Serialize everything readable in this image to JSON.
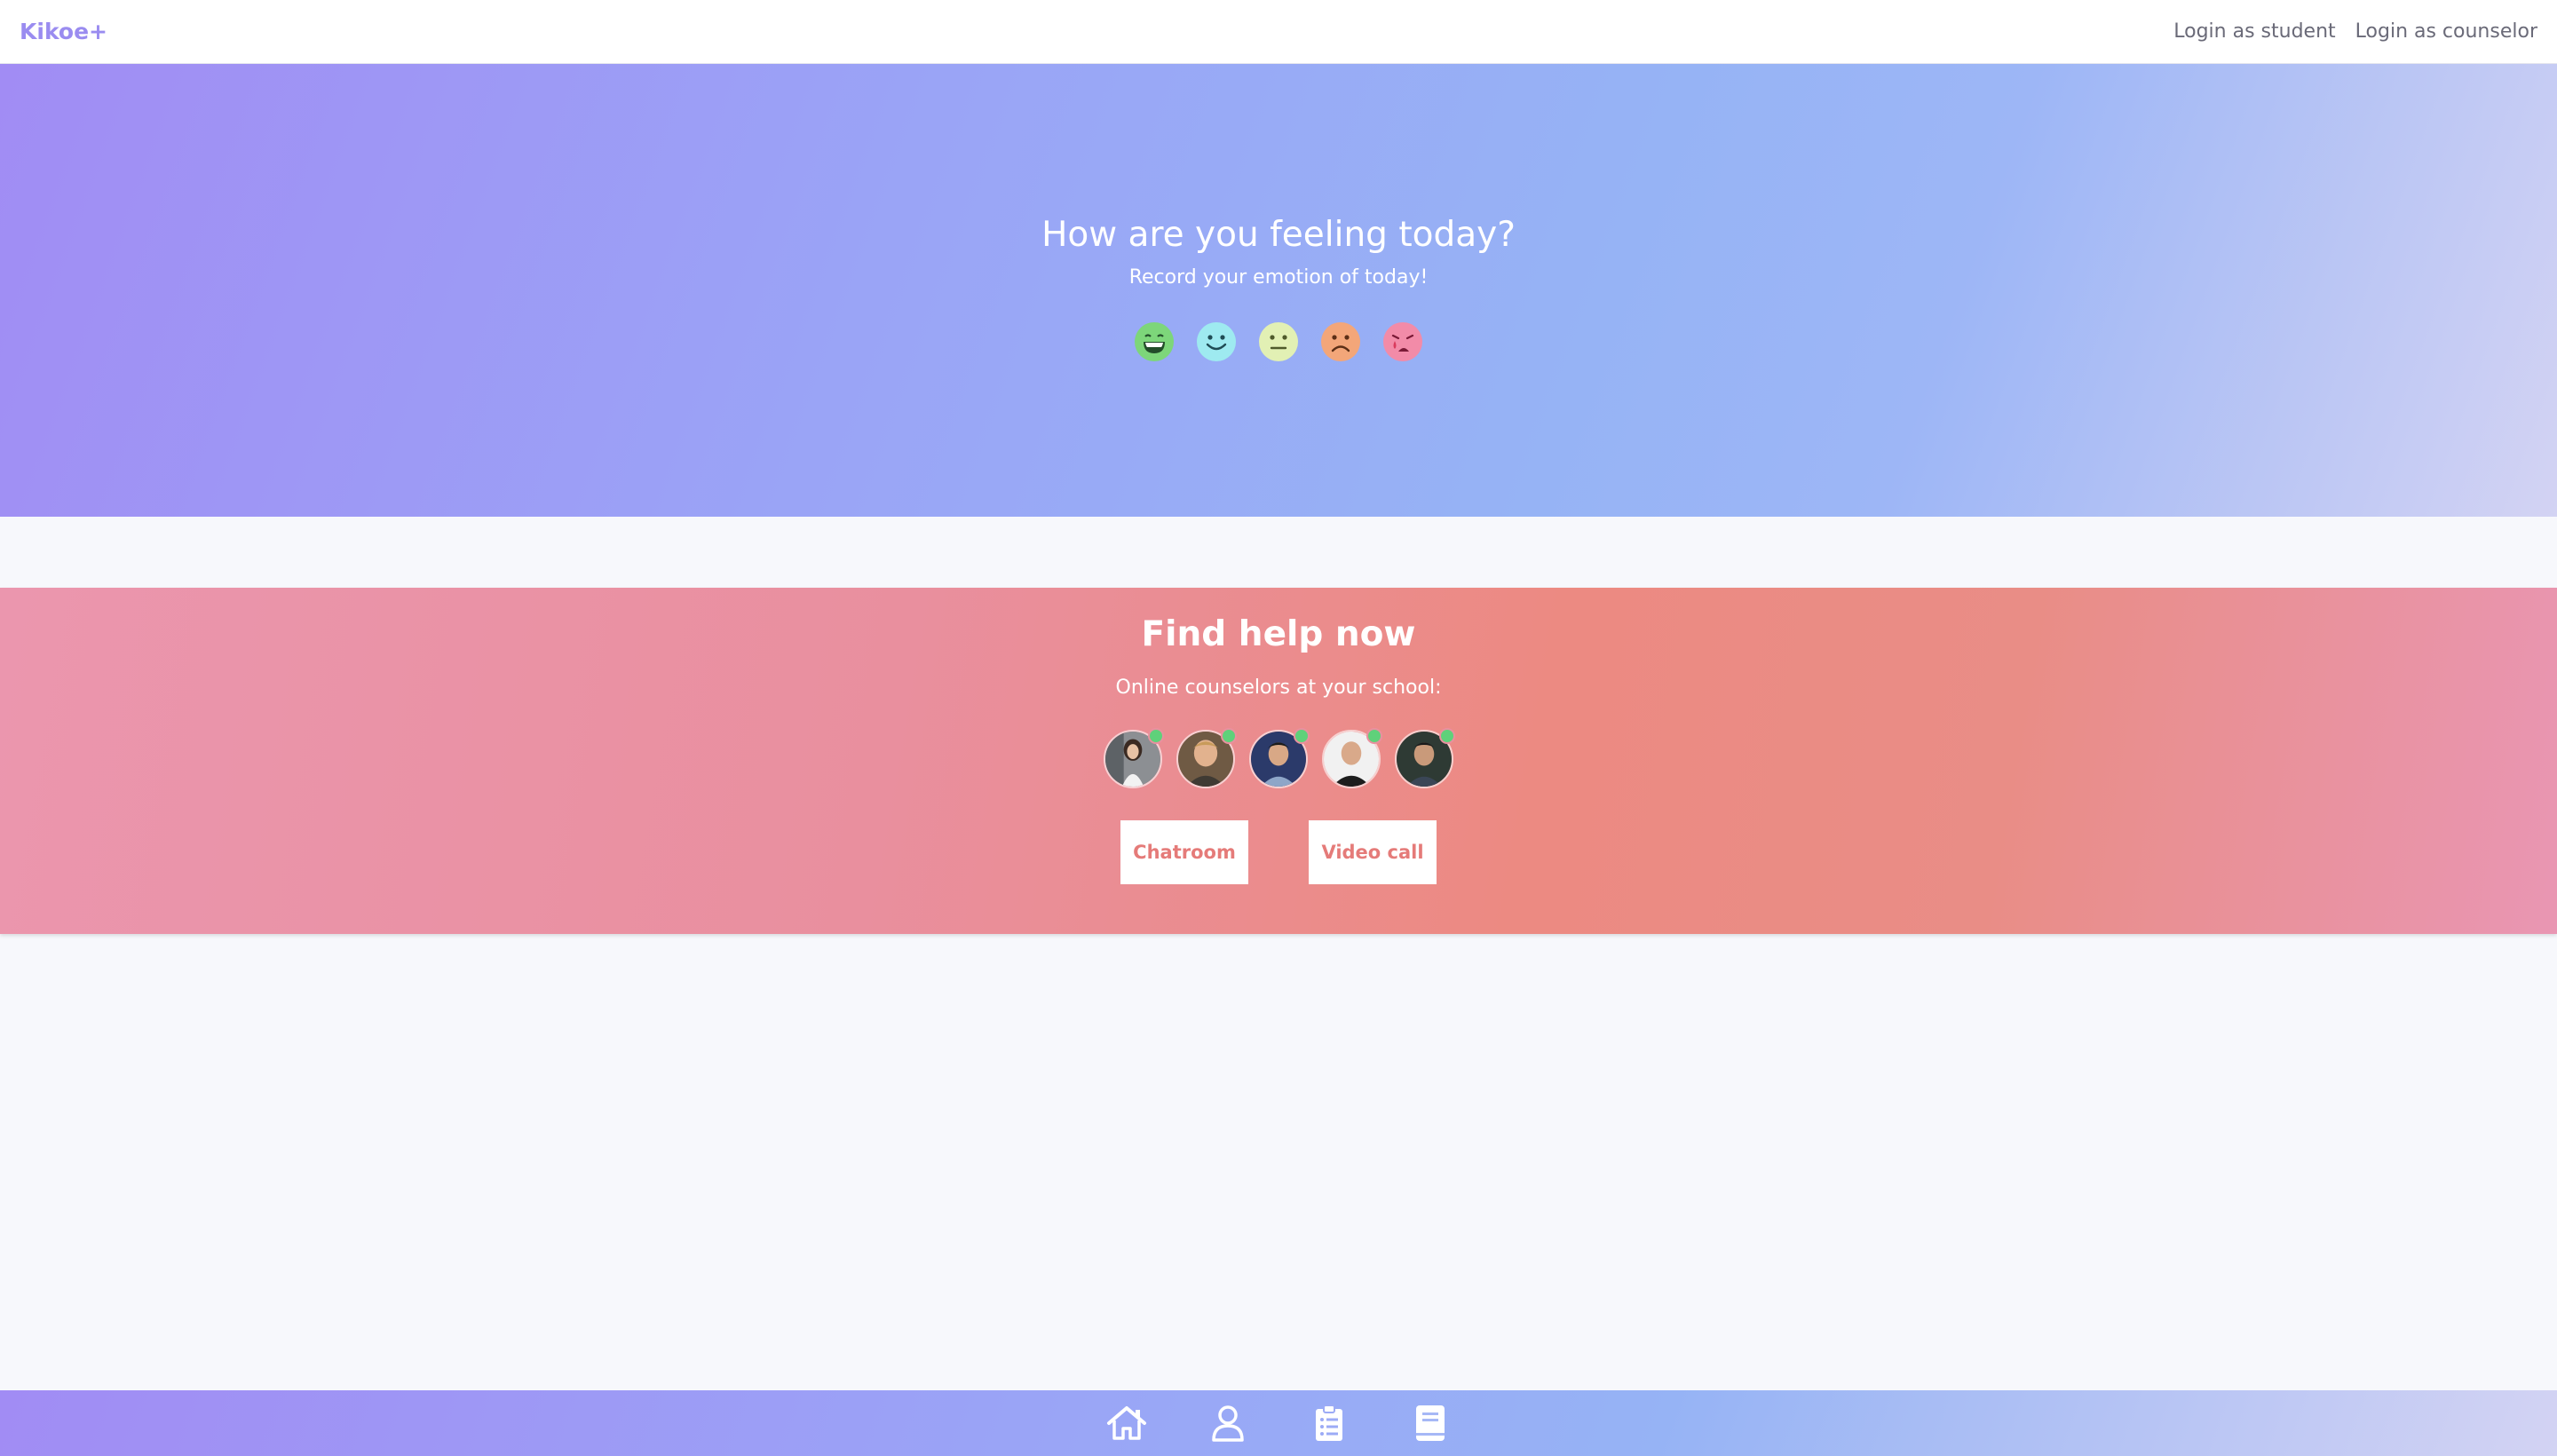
{
  "app": {
    "brand": "Kikoe+"
  },
  "nav": {
    "login_student": "Login as student",
    "login_counselor": "Login as counselor"
  },
  "hero": {
    "title": "How are you feeling today?",
    "subtitle": "Record your emotion of today!",
    "emotions": [
      {
        "icon": "grin-icon",
        "color": "#7dd67a"
      },
      {
        "icon": "smile-icon",
        "color": "#9eeaf0"
      },
      {
        "icon": "neutral-face-icon",
        "color": "#e2f0b4"
      },
      {
        "icon": "frown-icon",
        "color": "#f3a679"
      },
      {
        "icon": "crying-face-icon",
        "color": "#f28ba8"
      }
    ]
  },
  "help": {
    "title": "Find help now",
    "subtitle": "Online counselors at your school:",
    "counselors": [
      {
        "avatar": "counselor-avatar-1",
        "online": true
      },
      {
        "avatar": "counselor-avatar-2",
        "online": true
      },
      {
        "avatar": "counselor-avatar-3",
        "online": true
      },
      {
        "avatar": "counselor-avatar-4",
        "online": true
      },
      {
        "avatar": "counselor-avatar-5",
        "online": true
      }
    ],
    "chatroom_label": "Chatroom",
    "video_call_label": "Video call"
  },
  "bottom_nav": [
    "home-icon",
    "user-icon",
    "clipboard-list-icon",
    "book-icon"
  ],
  "colors": {
    "brand": "#9a8cf0",
    "accent_button_text": "#e57b79",
    "online_indicator": "#5fd17a"
  }
}
